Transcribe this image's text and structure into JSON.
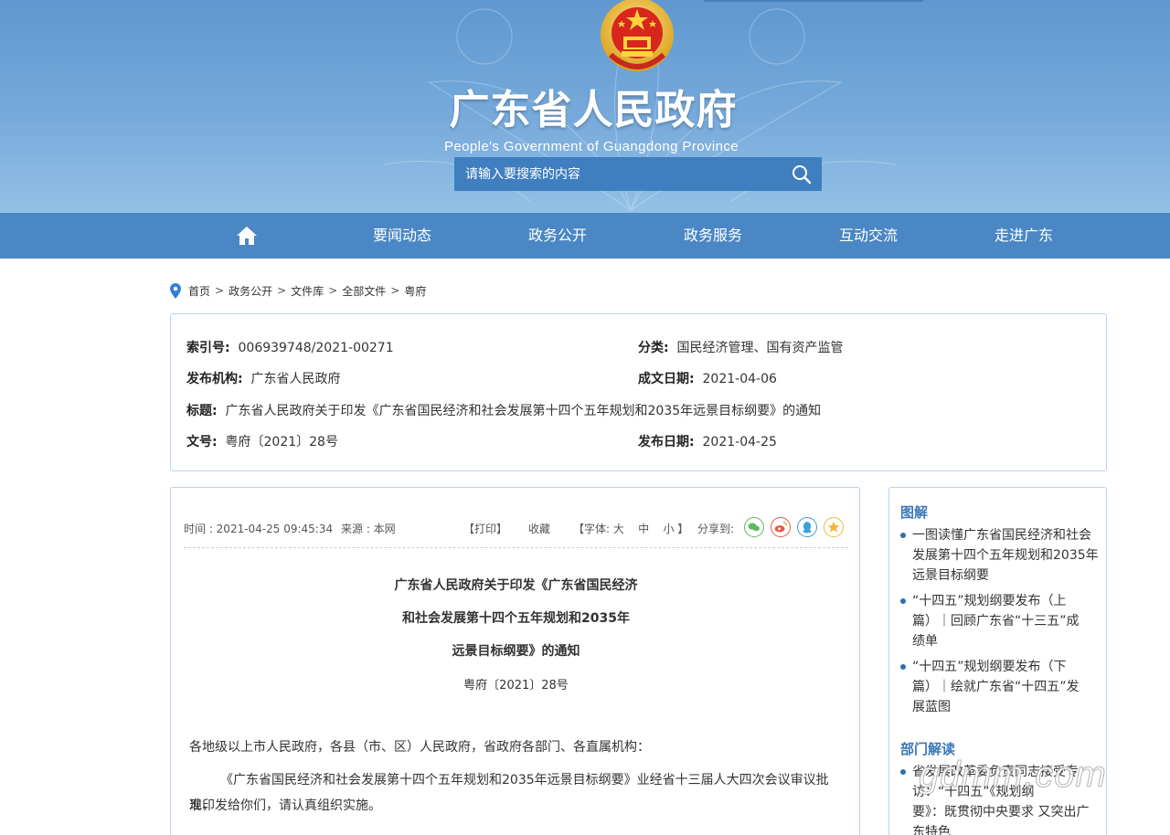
{
  "header": {
    "title_cn": "广东省人民政府",
    "title_en": "People's Government of Guangdong Province",
    "search_placeholder": "请输入要搜索的内容"
  },
  "nav": {
    "items": [
      "要闻动态",
      "政务公开",
      "政务服务",
      "互动交流",
      "走进广东"
    ]
  },
  "breadcrumb": [
    "首页",
    "政务公开",
    "文件库",
    "全部文件",
    "粤府"
  ],
  "meta": {
    "index_no_label": "索引号:",
    "index_no": "006939748/2021-00271",
    "category_label": "分类:",
    "category": "国民经济管理、国有资产监管",
    "publisher_label": "发布机构:",
    "publisher": "广东省人民政府",
    "written_date_label": "成文日期:",
    "written_date": "2021-04-06",
    "title_label": "标题:",
    "title": "广东省人民政府关于印发《广东省国民经济和社会发展第十四个五年规划和2035年远景目标纲要》的通知",
    "doc_no_label": "文号:",
    "doc_no": "粤府〔2021〕28号",
    "publish_date_label": "发布日期:",
    "publish_date": "2021-04-25"
  },
  "article": {
    "time": "时间 : 2021-04-25 09:45:34",
    "source": "来源 : 本网",
    "print": "【打印】",
    "favorite": "收藏",
    "font_size_prefix": "【字体:",
    "font_large": "大",
    "font_medium": "中",
    "font_small": "小",
    "font_size_suffix": "】",
    "share_label": "分享到:",
    "share_icons": [
      "wechat-icon",
      "weibo-icon",
      "qq-icon",
      "qzone-icon"
    ],
    "title_line1": "广东省人民政府关于印发《广东省国民经济",
    "title_line2": "和社会发展第十四个五年规划和2035年",
    "title_line3": "远景目标纲要》的通知",
    "doc_no": "粤府〔2021〕28号",
    "addressee": "各地级以上市人民政府，各县（市、区）人民政府，省政府各部门、各直属机构：",
    "body_line1": "《广东省国民经济和社会发展第十四个五年规划和2035年远景目标纲要》业经省十三届人大四次会议审议批准，",
    "body_line2": "现印发给你们，请认真组织实施。"
  },
  "sidebar": {
    "section1_title": "图解",
    "section1_items": [
      [
        "一图读懂广东省国民经济和社会",
        "发展第十四个五年规划和2035年",
        "远景目标纲要"
      ],
      [
        "“十四五”规划纲要发布（上",
        "篇）｜回顾广东省“十三五”成",
        "绩单"
      ],
      [
        "“十四五”规划纲要发布（下",
        "篇）｜绘就广东省“十四五”发",
        "展蓝图"
      ]
    ],
    "section2_title": "部门解读",
    "section2_items": [
      [
        "省发展改革委负责同志接受专",
        "访：“十四五”《规划纲",
        "要》：既贯彻中央要求 又突出广",
        "东特色"
      ]
    ]
  },
  "watermark": "gdmm.com",
  "colors": {
    "nav": "#4a87c4",
    "header": "#6fa3d6",
    "accent": "#3a78b8",
    "border": "#b9d3ea"
  }
}
